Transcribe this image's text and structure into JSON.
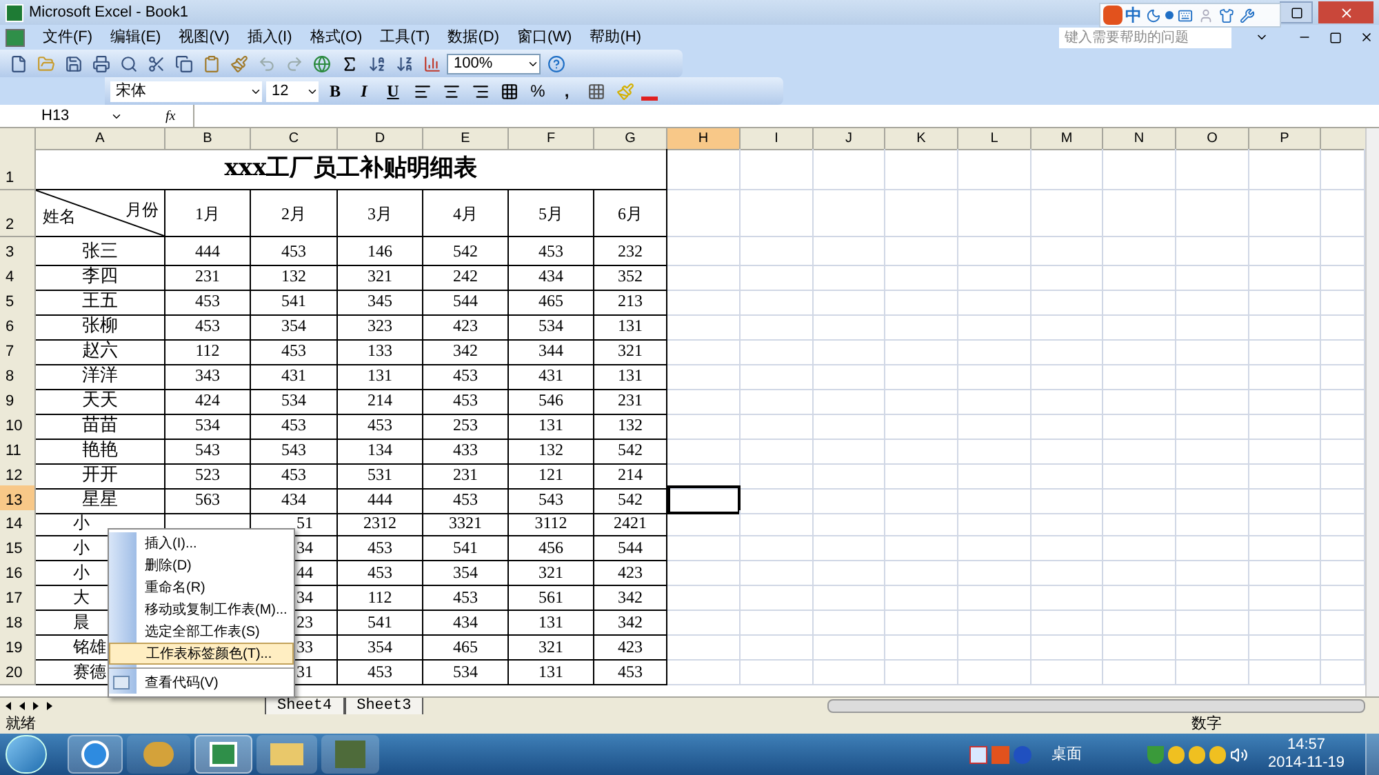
{
  "window": {
    "title": "Microsoft Excel - Book1"
  },
  "ime_bar": {
    "mode": "中"
  },
  "menu": [
    "文件(F)",
    "编辑(E)",
    "视图(V)",
    "插入(I)",
    "格式(O)",
    "工具(T)",
    "数据(D)",
    "窗口(W)",
    "帮助(H)"
  ],
  "help_box": {
    "placeholder": "键入需要帮助的问题"
  },
  "toolbar": {
    "zoom": "100%",
    "font": "宋体",
    "font_size": "12",
    "bold": "B",
    "italic": "I",
    "underline": "U",
    "percent": "%",
    "comma": ","
  },
  "formula_bar": {
    "name_box": "H13",
    "fx": "fx"
  },
  "columns": [
    {
      "label": "A",
      "selected": false
    },
    {
      "label": "B",
      "selected": false
    },
    {
      "label": "C",
      "selected": false
    },
    {
      "label": "D",
      "selected": false
    },
    {
      "label": "E",
      "selected": false
    },
    {
      "label": "F",
      "selected": false
    },
    {
      "label": "G",
      "selected": false
    },
    {
      "label": "H",
      "selected": true
    },
    {
      "label": "I",
      "selected": false
    },
    {
      "label": "J",
      "selected": false
    },
    {
      "label": "K",
      "selected": false
    },
    {
      "label": "L",
      "selected": false
    },
    {
      "label": "M",
      "selected": false
    },
    {
      "label": "N",
      "selected": false
    },
    {
      "label": "O",
      "selected": false
    },
    {
      "label": "P",
      "selected": false
    }
  ],
  "sheet": {
    "title_row": "1",
    "header_row": "2",
    "title": "xxx工厂员工补贴明细表",
    "corner_left": "姓名",
    "corner_right": "月份",
    "months": [
      "1月",
      "2月",
      "3月",
      "4月",
      "5月",
      "6月"
    ],
    "rows": [
      {
        "number": "3",
        "selected": false,
        "name": "张三",
        "values": [
          "444",
          "453",
          "146",
          "542",
          "453",
          "232"
        ]
      },
      {
        "number": "4",
        "selected": false,
        "name": "李四",
        "values": [
          "231",
          "132",
          "321",
          "242",
          "434",
          "352"
        ]
      },
      {
        "number": "5",
        "selected": false,
        "name": "王五",
        "values": [
          "453",
          "541",
          "345",
          "544",
          "465",
          "213"
        ]
      },
      {
        "number": "6",
        "selected": false,
        "name": "张柳",
        "values": [
          "453",
          "354",
          "323",
          "423",
          "534",
          "131"
        ]
      },
      {
        "number": "7",
        "selected": false,
        "name": "赵六",
        "values": [
          "112",
          "453",
          "133",
          "342",
          "344",
          "321"
        ]
      },
      {
        "number": "8",
        "selected": false,
        "name": "洋洋",
        "values": [
          "343",
          "431",
          "131",
          "453",
          "431",
          "131"
        ]
      },
      {
        "number": "9",
        "selected": false,
        "name": "天天",
        "values": [
          "424",
          "534",
          "214",
          "453",
          "546",
          "231"
        ]
      },
      {
        "number": "10",
        "selected": false,
        "name": "苗苗",
        "values": [
          "534",
          "453",
          "453",
          "253",
          "131",
          "132"
        ]
      },
      {
        "number": "11",
        "selected": false,
        "name": "艳艳",
        "values": [
          "543",
          "543",
          "134",
          "433",
          "132",
          "542"
        ]
      },
      {
        "number": "12",
        "selected": false,
        "name": "开开",
        "values": [
          "523",
          "453",
          "531",
          "231",
          "121",
          "214"
        ]
      },
      {
        "number": "13",
        "selected": true,
        "name": "星星",
        "values": [
          "563",
          "434",
          "444",
          "453",
          "543",
          "542"
        ]
      },
      {
        "number": "14",
        "selected": false,
        "kind": "under_menu",
        "name": "小",
        "values": [
          "51",
          "2312",
          "3321",
          "3112",
          "2421"
        ]
      },
      {
        "number": "15",
        "selected": false,
        "kind": "under_menu",
        "name": "小",
        "values": [
          "34",
          "453",
          "541",
          "456",
          "544"
        ]
      },
      {
        "number": "16",
        "selected": false,
        "kind": "under_menu",
        "name": "小",
        "values": [
          "44",
          "453",
          "354",
          "321",
          "423"
        ]
      },
      {
        "number": "17",
        "selected": false,
        "kind": "under_menu",
        "name": "大",
        "values": [
          "34",
          "112",
          "453",
          "561",
          "342"
        ]
      },
      {
        "number": "18",
        "selected": false,
        "kind": "under_menu",
        "name": "晨",
        "values": [
          "23",
          "541",
          "434",
          "131",
          "342"
        ]
      },
      {
        "number": "19",
        "selected": false,
        "kind": "under_menu",
        "name": "铭雄",
        "values": [
          "33",
          "354",
          "465",
          "321",
          "423"
        ]
      },
      {
        "number": "20",
        "selected": false,
        "kind": "under_menu",
        "name": "赛德",
        "values": [
          "31",
          "453",
          "534",
          "131",
          "453"
        ]
      }
    ]
  },
  "context_menu": [
    {
      "label": "插入(I)...",
      "selected": false
    },
    {
      "label": "删除(D)",
      "selected": false
    },
    {
      "label": "重命名(R)",
      "selected": false
    },
    {
      "label": "移动或复制工作表(M)...",
      "selected": false
    },
    {
      "label": "选定全部工作表(S)",
      "selected": false
    },
    {
      "label": "工作表标签颜色(T)...",
      "selected": true
    },
    {
      "label": "查看代码(V)",
      "selected": false,
      "kind": "icon"
    }
  ],
  "sheet_tabs": [
    {
      "label": "Sheet4",
      "selected": false
    },
    {
      "label": "Sheet3",
      "selected": false
    }
  ],
  "status_bar": {
    "left": "就绪",
    "right": "数字"
  },
  "taskbar": {
    "tray_label": "桌面",
    "time": "14:57",
    "date": "2014-11-19"
  }
}
